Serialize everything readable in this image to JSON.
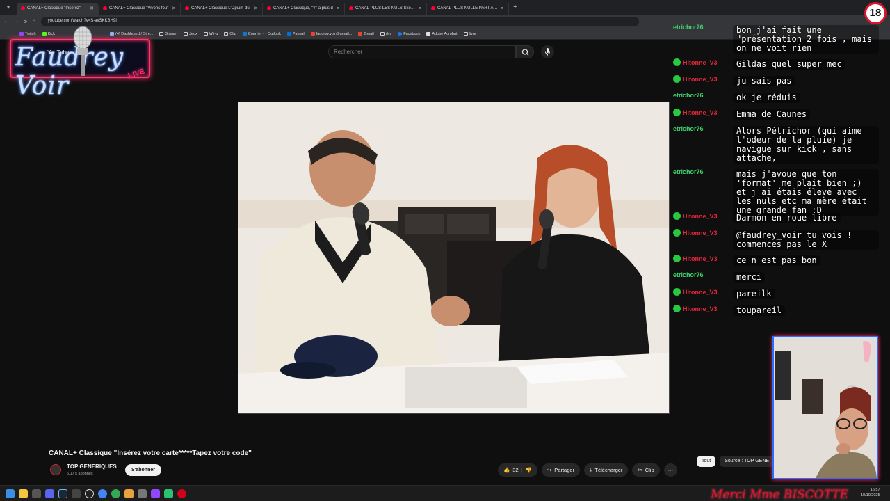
{
  "browser": {
    "tabs": [
      {
        "label": "CANAL+ Classique \"Insérez\"",
        "active": true
      },
      {
        "label": "CANAL+ Classique \"Vivons fou\""
      },
      {
        "label": "CANAL+ Classique L'Opium du"
      },
      {
        "label": "CANAL+ Classique, \"Y\" a plus d"
      },
      {
        "label": "CANAL PLUS LES NULS Sketch"
      },
      {
        "label": "CANAL PLUS NULLE PART AILL"
      }
    ],
    "url": "youtube.com/watch?v=S-avSKKBH9I",
    "bookmarks": [
      "Twitch",
      "Kick",
      "(4) Dashboard / Stre...",
      "Stream",
      "Jeux",
      "Wii-u",
      "Clip",
      "Courrier - - Outlook",
      "Paypal",
      "faudrey.voir@gmail...",
      "Gmail",
      "dys",
      "Facebook",
      "Adobe Acrobat",
      "livre"
    ]
  },
  "youtube": {
    "search_placeholder": "Rechercher",
    "video_title": "CANAL+ Classique \"Insérez votre carte*****Tapez votre code\"",
    "channel_name": "TOP GENERIQUES",
    "channel_subs": "6,17 k abonnés",
    "subscribe_label": "S'abonner",
    "likes": "32",
    "share_label": "Partager",
    "download_label": "Télécharger",
    "clip_label": "Clip",
    "chips": [
      "Tout",
      "Source : TOP GENE"
    ]
  },
  "overlay": {
    "logo_title": "Faudrey Voir",
    "logo_sub": "YouTube",
    "logo_live": "LIVE",
    "age_badge": "18",
    "footer_text": "Merci Mme BISCOTTE"
  },
  "chat": [
    {
      "user": "etrichor76",
      "color": "#3fd16b",
      "message": "bon j'ai fait une \"présentation 2 fois , mais on ne voit rien"
    },
    {
      "user": "Hitonne_V3",
      "color": "#e5283a",
      "message": "Gildas quel super mec"
    },
    {
      "user": "Hitonne_V3",
      "color": "#e5283a",
      "message": "ju sais pas"
    },
    {
      "user": "etrichor76",
      "color": "#3fd16b",
      "message": "ok je réduis"
    },
    {
      "user": "Hitonne_V3",
      "color": "#e5283a",
      "message": "Emma de Caunes"
    },
    {
      "user": "etrichor76",
      "color": "#3fd16b",
      "message": "Alors Pétrichor (qui aime l'odeur de la pluie) je navigue sur kick , sans attache,"
    },
    {
      "user": "etrichor76",
      "color": "#3fd16b",
      "message": "mais j'avoue que ton 'format' me plait bien ;) et j'ai étais élevé avec les nuls etc ma mère était une grande fan :D"
    },
    {
      "user": "Hitonne_V3",
      "color": "#e5283a",
      "message": "Darmon en roue libre"
    },
    {
      "user": "Hitonne_V3",
      "color": "#e5283a",
      "message": "@faudrey_voir tu vois ! commences pas le X"
    },
    {
      "user": "Hitonne_V3",
      "color": "#e5283a",
      "message": "ce n'est pas bon"
    },
    {
      "user": "etrichor76",
      "color": "#3fd16b",
      "message": "merci"
    },
    {
      "user": "Hitonne_V3",
      "color": "#e5283a",
      "message": "pareilk"
    },
    {
      "user": "Hitonne_V3",
      "color": "#e5283a",
      "message": "toupareil"
    }
  ],
  "taskbar": {
    "time": "16:57",
    "date": "10/10/2025"
  }
}
